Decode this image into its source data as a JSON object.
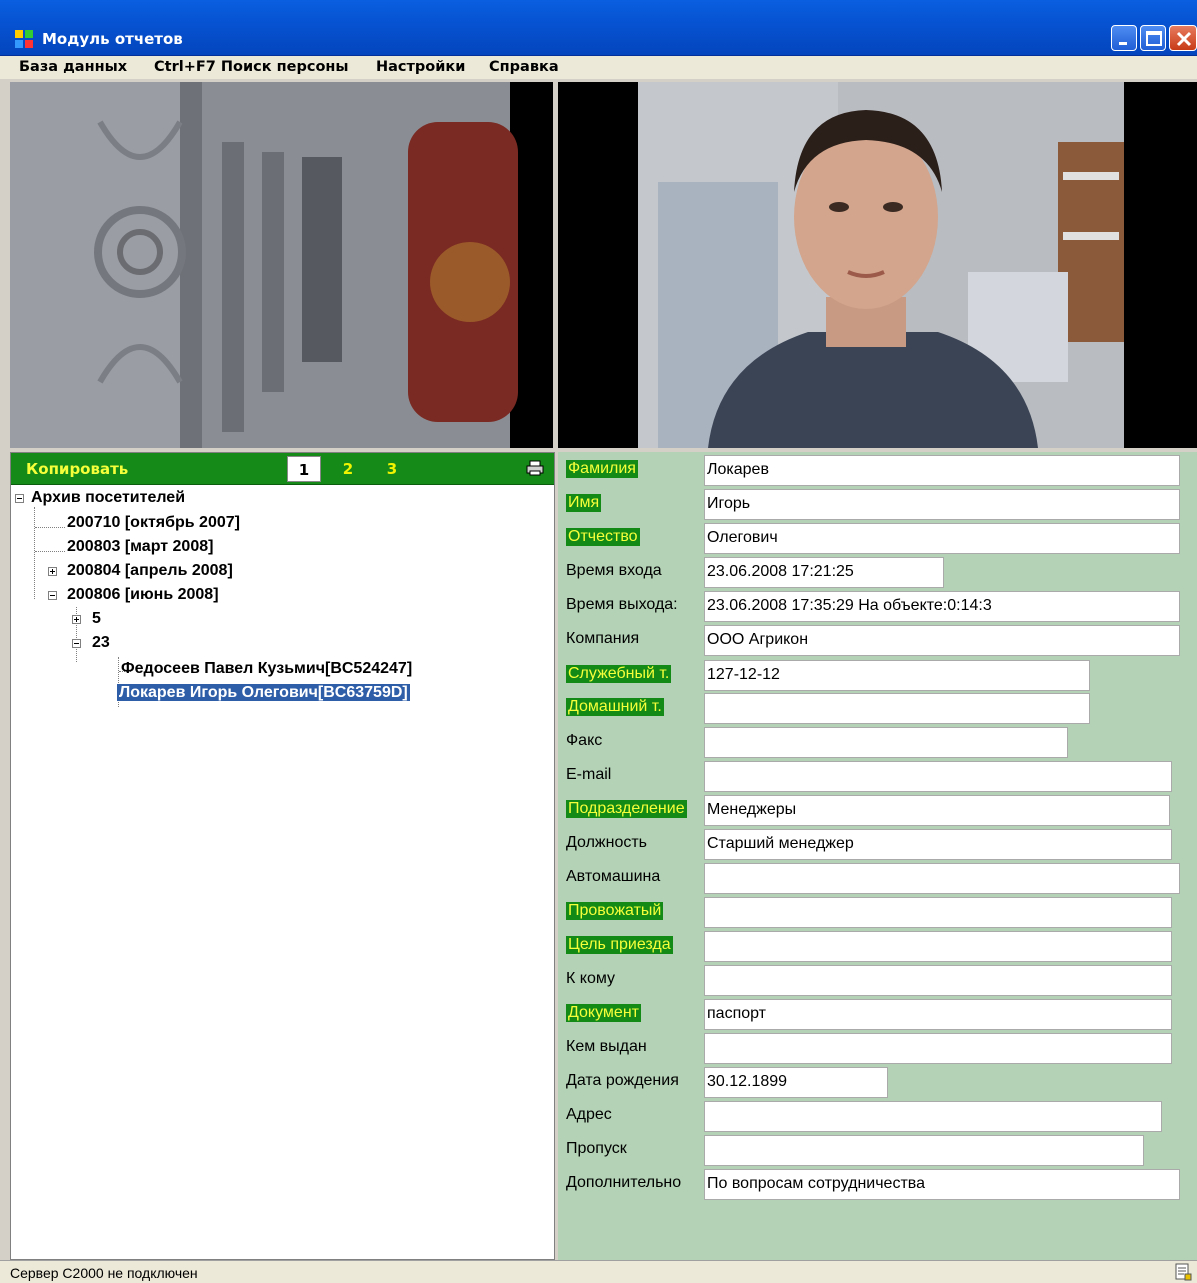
{
  "window": {
    "title": "Модуль отчетов"
  },
  "menu": [
    "База данных",
    "Ctrl+F7 Поиск персоны",
    "Настройки",
    "Справка"
  ],
  "toolbar": {
    "copy_label": "Копировать",
    "tabs": [
      "1",
      "2",
      "3"
    ],
    "active_tab": "1"
  },
  "tree": {
    "root": "Архив посетителей",
    "n1": "200710 [октябрь 2007]",
    "n2": "200803 [март 2008]",
    "n3": "200804 [апрель 2008]",
    "n4": "200806 [июнь 2008]",
    "n4a": "5",
    "n4b": "23",
    "p1": "Федосеев Павел Кузьмич[BC524247]",
    "p2": "Локарев Игорь Олегович[BC63759D]"
  },
  "form": [
    {
      "label": "Фамилия",
      "value": "Локарев",
      "highlight": true
    },
    {
      "label": "Имя",
      "value": "Игорь",
      "highlight": true
    },
    {
      "label": "Отчество",
      "value": "Олегович",
      "highlight": true
    },
    {
      "label": "Время входа",
      "value": "23.06.2008 17:21:25",
      "highlight": false
    },
    {
      "label": "Время выхода:",
      "value": "23.06.2008 17:35:29 На объекте:0:14:3",
      "highlight": false
    },
    {
      "label": "Компания",
      "value": "ООО Агрикон",
      "highlight": false
    },
    {
      "label": "Служебный т.",
      "value": "127-12-12",
      "highlight": true
    },
    {
      "label": "Домашний т.",
      "value": "",
      "highlight": true
    },
    {
      "label": "Факс",
      "value": "",
      "highlight": false
    },
    {
      "label": "E-mail",
      "value": "",
      "highlight": false
    },
    {
      "label": "Подразделение",
      "value": "Менеджеры",
      "highlight": true
    },
    {
      "label": "Должность",
      "value": "Старший менеджер",
      "highlight": false
    },
    {
      "label": "Автомашина",
      "value": "",
      "highlight": false
    },
    {
      "label": "Провожатый",
      "value": "",
      "highlight": true
    },
    {
      "label": "Цель приезда",
      "value": "",
      "highlight": true
    },
    {
      "label": "К кому",
      "value": "",
      "highlight": false
    },
    {
      "label": "Документ",
      "value": "паспорт",
      "highlight": true
    },
    {
      "label": "Кем выдан",
      "value": "",
      "highlight": false
    },
    {
      "label": "Дата рождения",
      "value": "30.12.1899",
      "highlight": false
    },
    {
      "label": "Адрес",
      "value": "",
      "highlight": false
    },
    {
      "label": "Пропуск",
      "value": "",
      "highlight": false
    },
    {
      "label": "Дополнительно",
      "value": "По вопросам сотрудничества",
      "highlight": false
    }
  ],
  "status": {
    "text": "Сервер С2000 не подключен"
  },
  "colors": {
    "titlebar": "#0652d1",
    "toolbar_green": "#158a18",
    "label_highlight": "#138a16",
    "highlight_text": "#f5ff3a",
    "form_bg": "#b4d3b6",
    "selection": "#2f5ea8"
  }
}
